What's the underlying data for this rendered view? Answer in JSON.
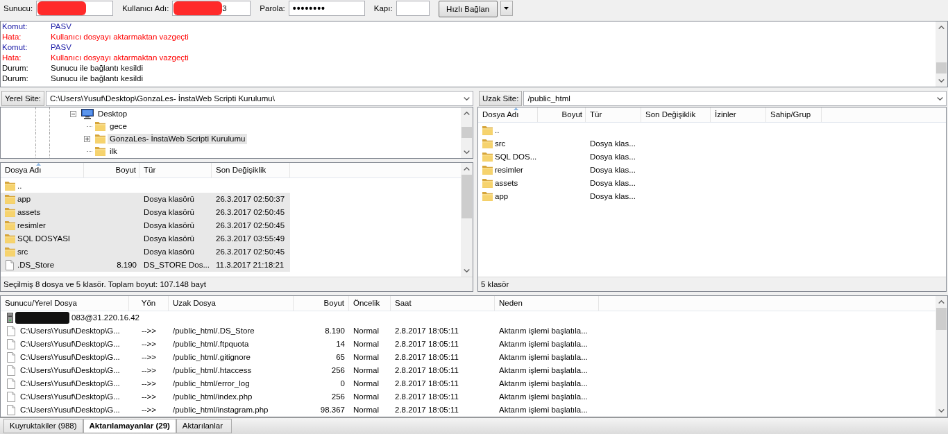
{
  "toolbar": {
    "fields": [
      {
        "kind": "host",
        "label": "Sunucu:",
        "redacted": true
      },
      {
        "kind": "user",
        "label": "Kullanıcı Adı:",
        "value": "3",
        "redacted": true
      },
      {
        "kind": "password",
        "label": "Parola:",
        "value": "••••••••"
      },
      {
        "kind": "port",
        "label": "Kapı:"
      }
    ],
    "quickconnect_button": "Hızlı Bağlan"
  },
  "message_log": [
    {
      "kind": "command",
      "label": "Komut:",
      "text": "PASV"
    },
    {
      "kind": "error",
      "label": "Hata:",
      "text": "Kullanıcı dosyayı aktarmaktan vazgeçti"
    },
    {
      "kind": "command",
      "label": "Komut:",
      "text": "PASV"
    },
    {
      "kind": "error",
      "label": "Hata:",
      "text": "Kullanıcı dosyayı aktarmaktan vazgeçti"
    },
    {
      "kind": "status",
      "label": "Durum:",
      "text": "Sunucu ile bağlantı kesildi"
    },
    {
      "kind": "status",
      "label": "Durum:",
      "text": "Sunucu ile bağlantı kesildi"
    }
  ],
  "local_site": {
    "label": "Yerel Site:",
    "path": "C:\\Users\\Yusuf\\Desktop\\GonzaLes- İnstaWeb Scripti Kurulumu\\",
    "tree": [
      {
        "kind": "desktop",
        "label": "Desktop",
        "expanded": true,
        "selected": false,
        "children": [
          {
            "kind": "folder",
            "label": "gece",
            "selected": false
          },
          {
            "kind": "folder",
            "label": "GonzaLes- İnstaWeb Scripti Kurulumu",
            "expanded": false,
            "selected": true
          },
          {
            "kind": "folder",
            "label": "ilk",
            "selected": false
          }
        ]
      }
    ],
    "columns": [
      {
        "label": "Dosya Adı",
        "sorted": true
      },
      {
        "label": "Boyut",
        "sorted": false
      },
      {
        "label": "Tür",
        "sorted": false
      },
      {
        "label": "Son Değişiklik",
        "sorted": false
      }
    ],
    "rows": [
      {
        "kind": "folder",
        "name": "..",
        "selected": false
      },
      {
        "kind": "folder",
        "name": "app",
        "type": "Dosya klasörü",
        "modified": "26.3.2017 02:50:37",
        "selected": true
      },
      {
        "kind": "folder",
        "name": "assets",
        "type": "Dosya klasörü",
        "modified": "26.3.2017 02:50:45",
        "selected": true
      },
      {
        "kind": "folder",
        "name": "resimler",
        "type": "Dosya klasörü",
        "modified": "26.3.2017 02:50:45",
        "selected": true
      },
      {
        "kind": "folder",
        "name": "SQL DOSYASI",
        "type": "Dosya klasörü",
        "modified": "26.3.2017 03:55:49",
        "selected": true
      },
      {
        "kind": "folder",
        "name": "src",
        "type": "Dosya klasörü",
        "modified": "26.3.2017 02:50:45",
        "selected": true
      },
      {
        "kind": "file",
        "name": ".DS_Store",
        "size": "8.190",
        "type": "DS_STORE Dos...",
        "modified": "11.3.2017 21:18:21",
        "selected": true
      }
    ],
    "status": "Seçilmiş 8 dosya ve 5 klasör. Toplam boyut: 107.148 bayt"
  },
  "remote_site": {
    "label": "Uzak Site:",
    "path": "/public_html",
    "columns": [
      {
        "label": "Dosya Adı",
        "sorted": true
      },
      {
        "label": "Boyut",
        "sorted": false
      },
      {
        "label": "Tür",
        "sorted": false
      },
      {
        "label": "Son Değişiklik",
        "sorted": false
      },
      {
        "label": "İzinler",
        "sorted": false
      },
      {
        "label": "Sahip/Grup",
        "sorted": false
      }
    ],
    "rows": [
      {
        "kind": "folder",
        "name": "..",
        "selected": false
      },
      {
        "kind": "folder",
        "name": "src",
        "type": "Dosya klas...",
        "selected": false
      },
      {
        "kind": "folder",
        "name": "SQL DOS...",
        "type": "Dosya klas...",
        "selected": false
      },
      {
        "kind": "folder",
        "name": "resimler",
        "type": "Dosya klas...",
        "selected": false
      },
      {
        "kind": "folder",
        "name": "assets",
        "type": "Dosya klas...",
        "selected": false
      },
      {
        "kind": "folder",
        "name": "app",
        "type": "Dosya klas...",
        "selected": false
      }
    ],
    "status": "5 klasör"
  },
  "queue": {
    "columns": [
      "Sunucu/Yerel Dosya",
      "Yön",
      "Uzak Dosya",
      "Boyut",
      "Öncelik",
      "Saat",
      "Neden"
    ],
    "server": {
      "address": "083@31.220.16.42",
      "redacted": true
    },
    "rows": [
      {
        "local_file": "C:\\Users\\Yusuf\\Desktop\\G...",
        "direction": "-->>",
        "remote_file": "/public_html/.DS_Store",
        "size": "8.190",
        "priority": "Normal",
        "time": "2.8.2017 18:05:11",
        "reason": "Aktarım işlemi başlatıla...",
        "selected": false
      },
      {
        "local_file": "C:\\Users\\Yusuf\\Desktop\\G...",
        "direction": "-->>",
        "remote_file": "/public_html/.ftpquota",
        "size": "14",
        "priority": "Normal",
        "time": "2.8.2017 18:05:11",
        "reason": "Aktarım işlemi başlatıla...",
        "selected": false
      },
      {
        "local_file": "C:\\Users\\Yusuf\\Desktop\\G...",
        "direction": "-->>",
        "remote_file": "/public_html/.gitignore",
        "size": "65",
        "priority": "Normal",
        "time": "2.8.2017 18:05:11",
        "reason": "Aktarım işlemi başlatıla...",
        "selected": false
      },
      {
        "local_file": "C:\\Users\\Yusuf\\Desktop\\G...",
        "direction": "-->>",
        "remote_file": "/public_html/.htaccess",
        "size": "256",
        "priority": "Normal",
        "time": "2.8.2017 18:05:11",
        "reason": "Aktarım işlemi başlatıla...",
        "selected": false
      },
      {
        "local_file": "C:\\Users\\Yusuf\\Desktop\\G...",
        "direction": "-->>",
        "remote_file": "/public_html/error_log",
        "size": "0",
        "priority": "Normal",
        "time": "2.8.2017 18:05:11",
        "reason": "Aktarım işlemi başlatıla...",
        "selected": false
      },
      {
        "local_file": "C:\\Users\\Yusuf\\Desktop\\G...",
        "direction": "-->>",
        "remote_file": "/public_html/index.php",
        "size": "256",
        "priority": "Normal",
        "time": "2.8.2017 18:05:11",
        "reason": "Aktarım işlemi başlatıla...",
        "selected": false
      },
      {
        "local_file": "C:\\Users\\Yusuf\\Desktop\\G...",
        "direction": "-->>",
        "remote_file": "/public_html/instagram.php",
        "size": "98.367",
        "priority": "Normal",
        "time": "2.8.2017 18:05:11",
        "reason": "Aktarım işlemi başlatıla...",
        "selected": false
      }
    ]
  },
  "queue_tabs": [
    {
      "label": "Kuyruktakiler (988)",
      "selected": false
    },
    {
      "label": "Aktarılamayanlar (29)",
      "selected": true
    },
    {
      "label": "Aktarılanlar",
      "selected": false
    }
  ]
}
